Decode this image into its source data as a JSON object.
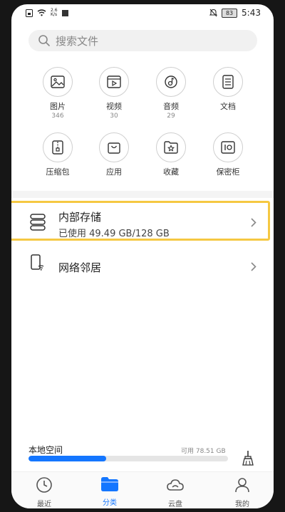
{
  "status": {
    "speed_value": "2.6",
    "speed_unit": "K/s",
    "battery": "83",
    "time": "5:43"
  },
  "search": {
    "placeholder": "搜索文件"
  },
  "categories": [
    {
      "label": "图片",
      "count": "346",
      "icon": "image-icon"
    },
    {
      "label": "视频",
      "count": "30",
      "icon": "video-icon"
    },
    {
      "label": "音频",
      "count": "29",
      "icon": "music-icon"
    },
    {
      "label": "文档",
      "count": "",
      "icon": "document-icon"
    },
    {
      "label": "压缩包",
      "count": "",
      "icon": "archive-icon"
    },
    {
      "label": "应用",
      "count": "",
      "icon": "shopping-bag-icon"
    },
    {
      "label": "收藏",
      "count": "",
      "icon": "star-folder-icon"
    },
    {
      "label": "保密柜",
      "count": "",
      "icon": "safe-icon"
    }
  ],
  "storage": {
    "internal_title": "内部存储",
    "internal_usage": "已使用 49.49 GB/128 GB",
    "network_title": "网络邻居"
  },
  "local_space": {
    "label": "本地空间",
    "free": "可用 78.51 GB",
    "used_fraction": 0.39
  },
  "tabs": [
    {
      "label": "最近",
      "icon": "clock-icon",
      "active": false
    },
    {
      "label": "分类",
      "icon": "folder-icon",
      "active": true
    },
    {
      "label": "云盘",
      "icon": "cloud-icon",
      "active": false
    },
    {
      "label": "我的",
      "icon": "person-icon",
      "active": false
    }
  ],
  "colors": {
    "accent": "#1476ff",
    "highlight": "#f5c842"
  }
}
